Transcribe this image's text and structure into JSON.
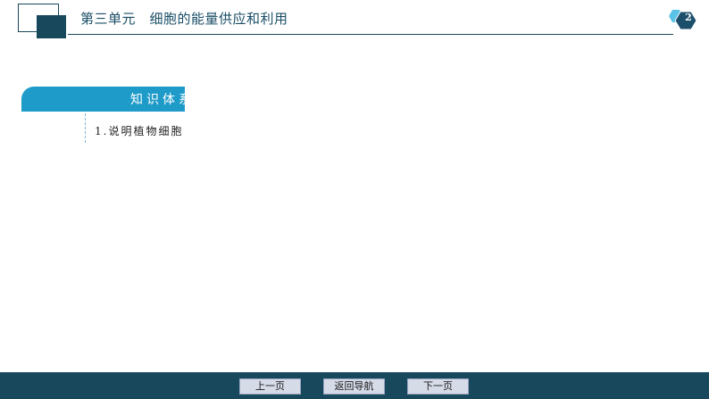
{
  "header": {
    "title": "第三单元　细胞的能量供应和利用",
    "page_number": "2",
    "colors": {
      "primary": "#17485c",
      "badge_light": "#5bc2e7",
      "badge_dark": "#1b4f6a"
    },
    "badge_icon": "hexagon-icon"
  },
  "section": {
    "tab_label": "知识体系",
    "body_text": "1.说明植物细胞",
    "tab_color": "#1e9bc8"
  },
  "footer": {
    "prev_label": "上一页",
    "home_label": "返回导航",
    "next_label": "下一页"
  }
}
